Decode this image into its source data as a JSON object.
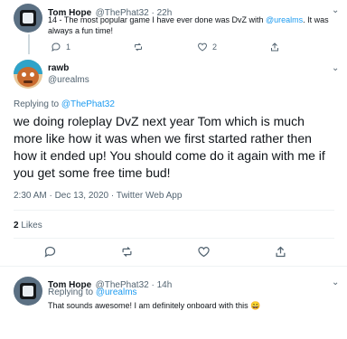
{
  "tweet1": {
    "name": "Tom Hope",
    "handle_time": "@ThePhat32 · 22h",
    "text_prefix": "14 - The most popular game I have ever done was DvZ with ",
    "mention": "@urealms",
    "text_suffix": ". It was always a fun time!",
    "reply_count": "1",
    "retweet_count": "",
    "like_count": "2"
  },
  "main": {
    "name": "rawb",
    "handle": "@urealms",
    "replying_label": "Replying to ",
    "replying_to": "@ThePhat32",
    "text": "we doing roleplay DvZ next year Tom which is much more like how it was when we first started rather then how it ended up! You should come do it again with me if you get some free time bud!",
    "timestamp": "2:30 AM · Dec 13, 2020 · Twitter Web App",
    "likes_count": "2",
    "likes_label": "Likes"
  },
  "reply": {
    "name": "Tom Hope",
    "handle_time": "@ThePhat32 · 14h",
    "replying_label": "Replying to ",
    "replying_to": "@urealms",
    "text": "That sounds awesome! I am definitely onboard with this 😄"
  },
  "colors": {
    "accent": "#1d9bf0",
    "secondary_text": "#536471",
    "divider": "#eff3f4"
  },
  "icons": [
    "more-icon",
    "reply-icon",
    "retweet-icon",
    "like-icon",
    "share-icon"
  ]
}
